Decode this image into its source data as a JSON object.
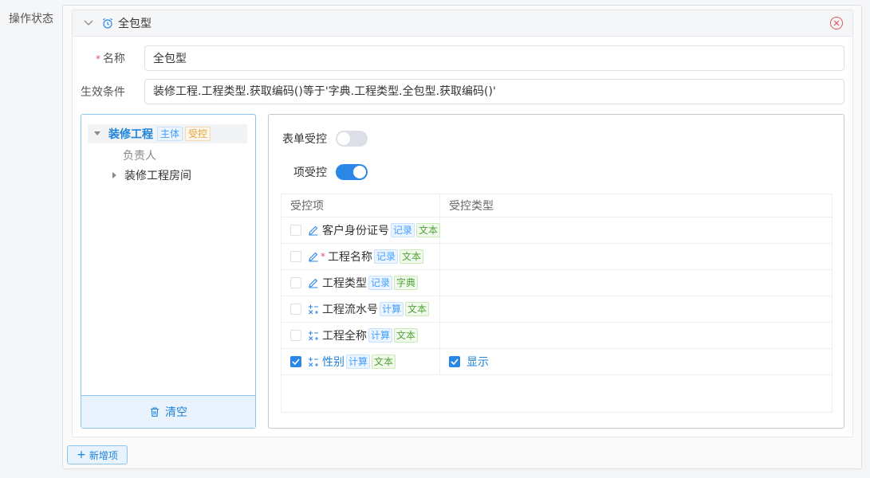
{
  "page": {
    "op_label": "操作状态"
  },
  "card": {
    "title": "全包型",
    "name_label": "名称",
    "name_value": "全包型",
    "condition_label": "生效条件",
    "condition_value": "装修工程.工程类型.获取编码()等于'字典.工程类型.全包型.获取编码()'"
  },
  "tree": {
    "root_label": "装修工程",
    "root_tags": [
      "主体",
      "受控"
    ],
    "children": [
      "负责人",
      "装修工程房间"
    ],
    "clear_label": "清空"
  },
  "controls": {
    "form_control_label": "表单受控",
    "form_control_on": false,
    "item_control_label": "项受控",
    "item_control_on": true
  },
  "table": {
    "headers": [
      "受控项",
      "受控类型"
    ],
    "rows": [
      {
        "name": "客户身份证号",
        "icon": "edit-icon",
        "required": false,
        "tags": [
          "记录",
          "文本"
        ],
        "checked": false,
        "type_label": ""
      },
      {
        "name": "工程名称",
        "icon": "edit-icon",
        "required": true,
        "tags": [
          "记录",
          "文本"
        ],
        "checked": false,
        "type_label": ""
      },
      {
        "name": "工程类型",
        "icon": "edit-icon",
        "required": false,
        "tags": [
          "记录",
          "字典"
        ],
        "checked": false,
        "type_label": ""
      },
      {
        "name": "工程流水号",
        "icon": "calc-icon",
        "required": false,
        "tags": [
          "计算",
          "文本"
        ],
        "checked": false,
        "type_label": ""
      },
      {
        "name": "工程全称",
        "icon": "calc-icon",
        "required": false,
        "tags": [
          "计算",
          "文本"
        ],
        "checked": false,
        "type_label": ""
      },
      {
        "name": "性别",
        "icon": "calc-icon",
        "required": false,
        "tags": [
          "计算",
          "文本"
        ],
        "checked": true,
        "type_label": "显示"
      }
    ]
  },
  "footer": {
    "add_label": "新增项"
  },
  "colors": {
    "accent": "#2b87e6",
    "required": "#e0565b"
  }
}
